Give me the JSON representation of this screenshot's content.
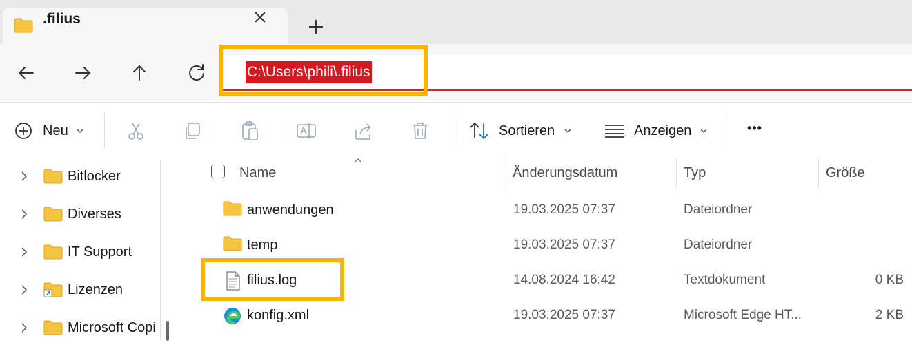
{
  "tab": {
    "title": ".filius",
    "close_icon": "close-icon",
    "new_tab_icon": "plus-icon"
  },
  "nav": {
    "back_icon": "arrow-left-icon",
    "forward_icon": "arrow-right-icon",
    "up_icon": "arrow-up-icon",
    "refresh_icon": "refresh-icon",
    "address": "C:\\Users\\phili\\.filius"
  },
  "toolbar": {
    "new_label": "Neu",
    "sort_label": "Sortieren",
    "view_label": "Anzeigen",
    "more_label": "•••"
  },
  "sidebar": {
    "items": [
      {
        "label": "Bitlocker"
      },
      {
        "label": "Diverses"
      },
      {
        "label": "IT Support"
      },
      {
        "label": "Lizenzen"
      },
      {
        "label": "Microsoft Copi"
      }
    ]
  },
  "columns": {
    "name": "Name",
    "date": "Änderungsdatum",
    "type": "Typ",
    "size": "Größe"
  },
  "files": [
    {
      "name": "anwendungen",
      "date": "19.03.2025 07:37",
      "type": "Dateiordner",
      "size": "",
      "icon": "folder-icon"
    },
    {
      "name": "temp",
      "date": "19.03.2025 07:37",
      "type": "Dateiordner",
      "size": "",
      "icon": "folder-icon"
    },
    {
      "name": "filius.log",
      "date": "14.08.2024 16:42",
      "type": "Textdokument",
      "size": "0 KB",
      "icon": "text-file-icon"
    },
    {
      "name": "konfig.xml",
      "date": "19.03.2025 07:37",
      "type": "Microsoft Edge HT...",
      "size": "2 KB",
      "icon": "edge-icon"
    }
  ],
  "colors": {
    "highlight": "#f7b500",
    "address_selection": "#d7181f",
    "folder": "#f5c542"
  }
}
